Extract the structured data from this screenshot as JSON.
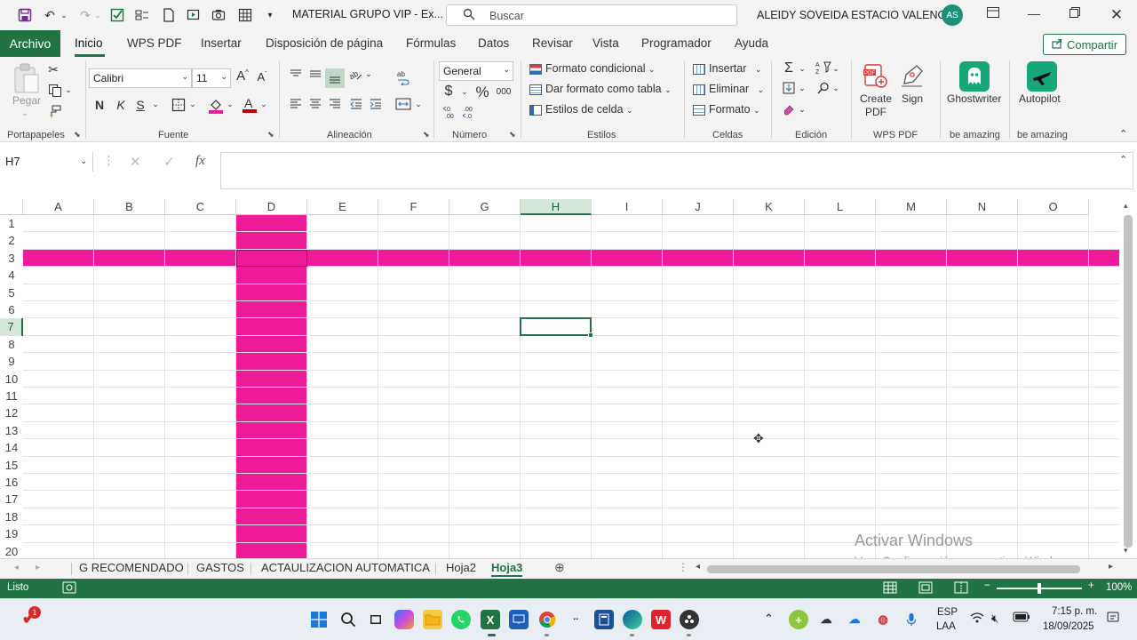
{
  "titlebar": {
    "document_title": "MATERIAL GRUPO VIP  -  Ex...",
    "search_placeholder": "Buscar",
    "user_name": "ALEIDY SOVEIDA ESTACIO VALENCIA",
    "user_initials": "AS"
  },
  "ribbon_tabs": [
    "Archivo",
    "Inicio",
    "WPS PDF",
    "Insertar",
    "Disposición de página",
    "Fórmulas",
    "Datos",
    "Revisar",
    "Vista",
    "Programador",
    "Ayuda"
  ],
  "share_label": "Compartir",
  "ribbon": {
    "paste_label": "Pegar",
    "font_name": "Calibri",
    "font_size": "11",
    "bold": "N",
    "italic": "K",
    "underline": "S",
    "number_format": "General",
    "currency_symbol": "$",
    "percent_symbol": "%",
    "thousands": "000",
    "conditional_format": "Formato condicional",
    "format_as_table": "Dar formato como tabla",
    "cell_styles": "Estilos de celda",
    "insert": "Insertar",
    "delete": "Eliminar",
    "format": "Formato",
    "create_pdf": "Create PDF",
    "sign": "Sign",
    "ghostwriter": "Ghostwriter",
    "autopilot": "Autopilot",
    "groups": {
      "clipboard": "Portapapeles",
      "font": "Fuente",
      "alignment": "Alineación",
      "number": "Número",
      "styles": "Estilos",
      "cells": "Celdas",
      "editing": "Edición",
      "wps_pdf": "WPS PDF",
      "be_amazing_1": "be amazing",
      "be_amazing_2": "be amazing"
    }
  },
  "formula_bar": {
    "name_box": "H7",
    "formula": ""
  },
  "grid": {
    "columns": [
      "A",
      "B",
      "C",
      "D",
      "E",
      "F",
      "G",
      "H",
      "I",
      "J",
      "K",
      "L",
      "M",
      "N",
      "O"
    ],
    "rows": [
      "1",
      "2",
      "3",
      "4",
      "5",
      "6",
      "7",
      "8",
      "9",
      "10",
      "11",
      "12",
      "13",
      "14",
      "15",
      "16",
      "17",
      "18",
      "19",
      "20"
    ],
    "selected_cell": "H7",
    "filled_column": "D",
    "filled_row": "3",
    "fill_color": "#ee1b98"
  },
  "watermark": {
    "line1": "Activar Windows",
    "line2": "Ve a Configuración para activar Windows."
  },
  "sheet_tabs": [
    "G RECOMENDADO",
    "GASTOS",
    "ACTAULIZACION AUTOMATICA",
    "Hoja2",
    "Hoja3"
  ],
  "active_sheet": "Hoja3",
  "status": {
    "ready": "Listo",
    "zoom": "100%"
  },
  "taskbar": {
    "notification_count": "1",
    "language": "ESP",
    "keyboard": "LAA",
    "time": "7:15 p. m.",
    "date": "18/09/2025"
  },
  "colors": {
    "excel_green": "#217346",
    "highlight_pink": "#ee1b98"
  }
}
